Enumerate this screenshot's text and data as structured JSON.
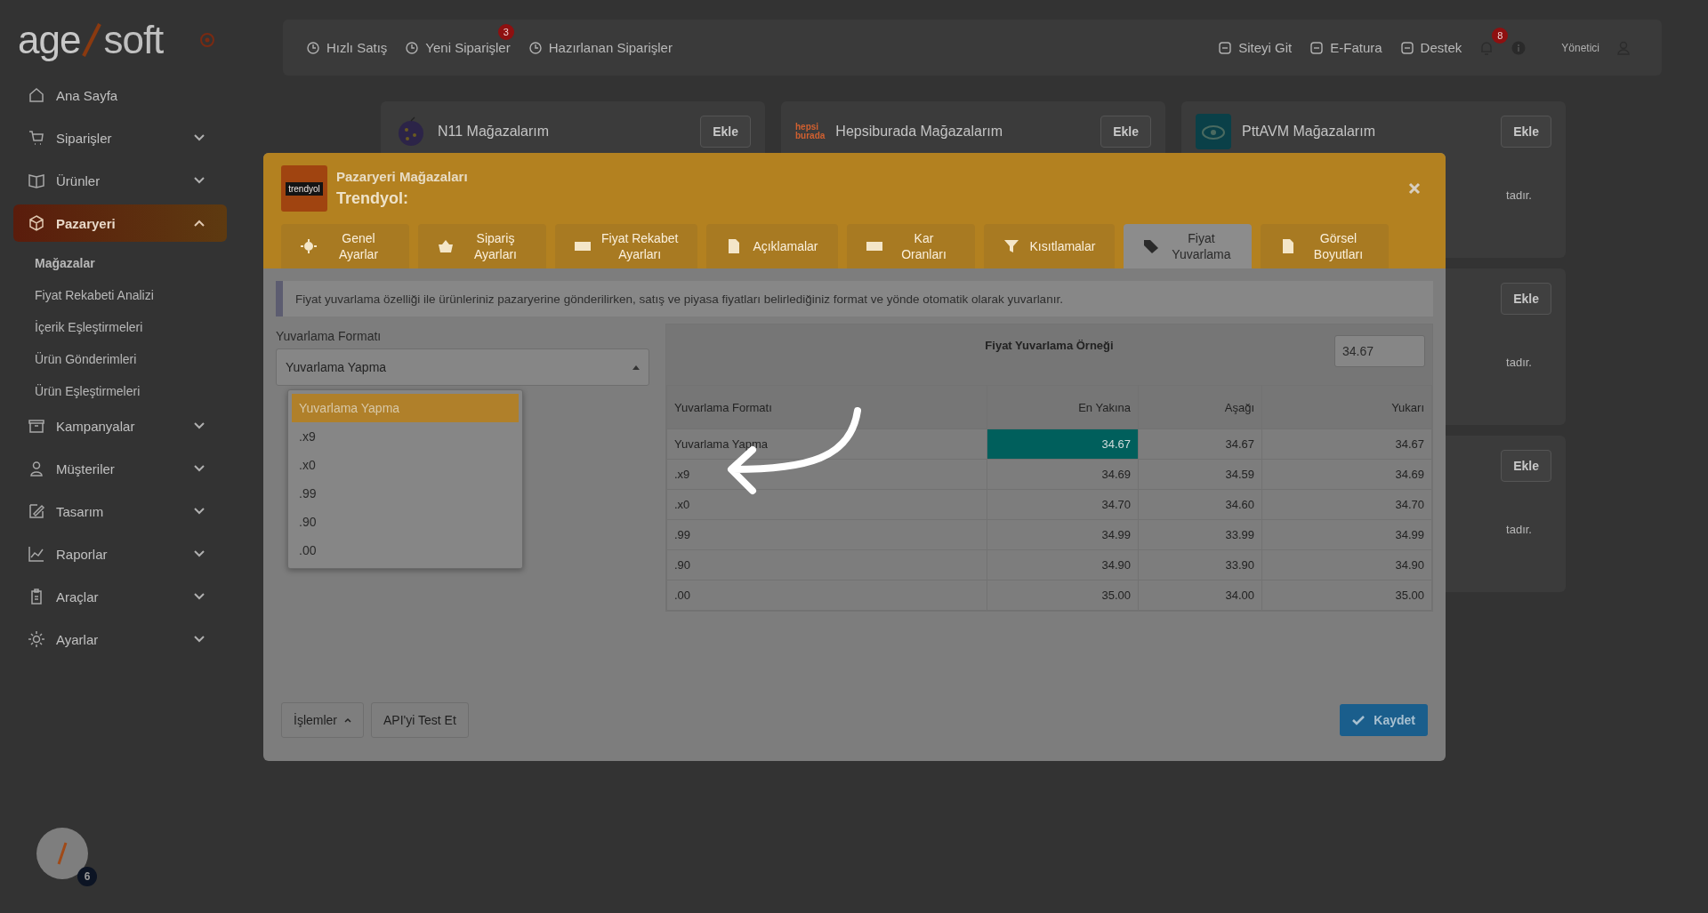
{
  "sidebar": {
    "logo": {
      "first": "age",
      "second": "soft"
    },
    "menu": [
      {
        "label": "Ana Sayfa",
        "kind": "link",
        "selected": false
      },
      {
        "label": "Siparişler",
        "kind": "group",
        "selected": false,
        "expanded": false
      },
      {
        "label": "Ürünler",
        "kind": "group",
        "selected": false,
        "expanded": false
      },
      {
        "label": "Pazaryeri",
        "kind": "group",
        "selected": true,
        "expanded": true,
        "children": [
          {
            "label": "Mağazalar",
            "selected": true
          },
          {
            "label": "Fiyat Rekabeti Analizi",
            "selected": false
          },
          {
            "label": "İçerik Eşleştirmeleri",
            "selected": false
          },
          {
            "label": "Ürün Gönderimleri",
            "selected": false
          },
          {
            "label": "Ürün Eşleştirmeleri",
            "selected": false
          }
        ]
      },
      {
        "label": "Kampanyalar",
        "kind": "group",
        "selected": false,
        "expanded": false
      },
      {
        "label": "Müşteriler",
        "kind": "group",
        "selected": false,
        "expanded": false
      },
      {
        "label": "Tasarım",
        "kind": "group",
        "selected": false,
        "expanded": false
      },
      {
        "label": "Raporlar",
        "kind": "group",
        "selected": false,
        "expanded": false
      },
      {
        "label": "Araçlar",
        "kind": "group",
        "selected": false,
        "expanded": false
      },
      {
        "label": "Ayarlar",
        "kind": "group",
        "selected": false,
        "expanded": false
      }
    ]
  },
  "floating_button": {
    "badge": "6"
  },
  "topbar": {
    "left": [
      {
        "label": "Hızlı Satış"
      },
      {
        "label": "Yeni Siparişler",
        "badge": "3"
      },
      {
        "label": "Hazırlanan Siparişler"
      }
    ],
    "right": [
      {
        "label": "Siteyi Git"
      },
      {
        "label": "E-Fatura"
      },
      {
        "label": "Destek"
      }
    ],
    "notifications_badge": "8",
    "user": "Yönetici"
  },
  "store_cards": [
    {
      "title": "N11 Mağazalarım",
      "button": "Ekle"
    },
    {
      "title": "Hepsiburada Mağazalarım",
      "button": "Ekle",
      "logo_lines": [
        "hepsi",
        "burada"
      ]
    },
    {
      "title": "PttAVM Mağazalarım",
      "button": "Ekle",
      "text_end": "tadır."
    },
    {
      "button": "Ekle",
      "text_end": "tadır."
    },
    {
      "button": "Ekle",
      "text_end": "tadır."
    }
  ],
  "modal": {
    "logo": "trendyol",
    "title": "Pazaryeri Mağazaları",
    "subtitle": "Trendyol:",
    "tabs": [
      {
        "label": "Genel\nAyarlar",
        "selected": false
      },
      {
        "label": "Sipariş\nAyarları",
        "selected": false
      },
      {
        "label": "Fiyat Rekabet\nAyarları",
        "selected": false
      },
      {
        "label": "Açıklamalar",
        "selected": false
      },
      {
        "label": "Kar\nOranları",
        "selected": false
      },
      {
        "label": "Kısıtlamalar",
        "selected": false
      },
      {
        "label": "Fiyat\nYuvarlama",
        "selected": true
      },
      {
        "label": "Görsel\nBoyutları",
        "selected": false
      }
    ],
    "note": "Fiyat yuvarlama özelliği ile ürünleriniz pazaryerine gönderilirken, satış ve piyasa fiyatları belirlediğiniz format ve yönde otomatik olarak yuvarlanır.",
    "format_field": {
      "label": "Yuvarlama Formatı",
      "value": "Yuvarlama Yapma",
      "expanded": true,
      "options": [
        {
          "label": "Yuvarlama Yapma",
          "selected": true
        },
        {
          "label": ".x9",
          "selected": false
        },
        {
          "label": ".x0",
          "selected": false
        },
        {
          "label": ".99",
          "selected": false
        },
        {
          "label": ".90",
          "selected": false
        },
        {
          "label": ".00",
          "selected": false
        }
      ]
    },
    "example": {
      "title": "Fiyat Yuvarlama Örneği",
      "input_value": "34.67",
      "columns": [
        "Yuvarlama Formatı",
        "En Yakına",
        "Aşağı",
        "Yukarı"
      ],
      "rows": [
        {
          "format": "Yuvarlama Yapma",
          "values": [
            {
              "text": "34.67",
              "highlighted": true
            },
            {
              "text": "34.67",
              "highlighted": false
            },
            {
              "text": "34.67",
              "highlighted": false
            }
          ]
        },
        {
          "format": ".x9",
          "values": [
            {
              "text": "34.69",
              "highlighted": false
            },
            {
              "text": "34.59",
              "highlighted": false
            },
            {
              "text": "34.69",
              "highlighted": false
            }
          ]
        },
        {
          "format": ".x0",
          "values": [
            {
              "text": "34.70",
              "highlighted": false
            },
            {
              "text": "34.60",
              "highlighted": false
            },
            {
              "text": "34.70",
              "highlighted": false
            }
          ]
        },
        {
          "format": ".99",
          "values": [
            {
              "text": "34.99",
              "highlighted": false
            },
            {
              "text": "33.99",
              "highlighted": false
            },
            {
              "text": "34.99",
              "highlighted": false
            }
          ]
        },
        {
          "format": ".90",
          "values": [
            {
              "text": "34.90",
              "highlighted": false
            },
            {
              "text": "33.90",
              "highlighted": false
            },
            {
              "text": "34.90",
              "highlighted": false
            }
          ]
        },
        {
          "format": ".00",
          "values": [
            {
              "text": "35.00",
              "highlighted": false
            },
            {
              "text": "34.00",
              "highlighted": false
            },
            {
              "text": "35.00",
              "highlighted": false
            }
          ]
        }
      ]
    },
    "footer_buttons": [
      {
        "label": "İşlemler",
        "kind": "menu"
      },
      {
        "label": "API'yi Test Et",
        "kind": "plain"
      },
      {
        "label": "Kaydet",
        "kind": "primary"
      }
    ]
  }
}
